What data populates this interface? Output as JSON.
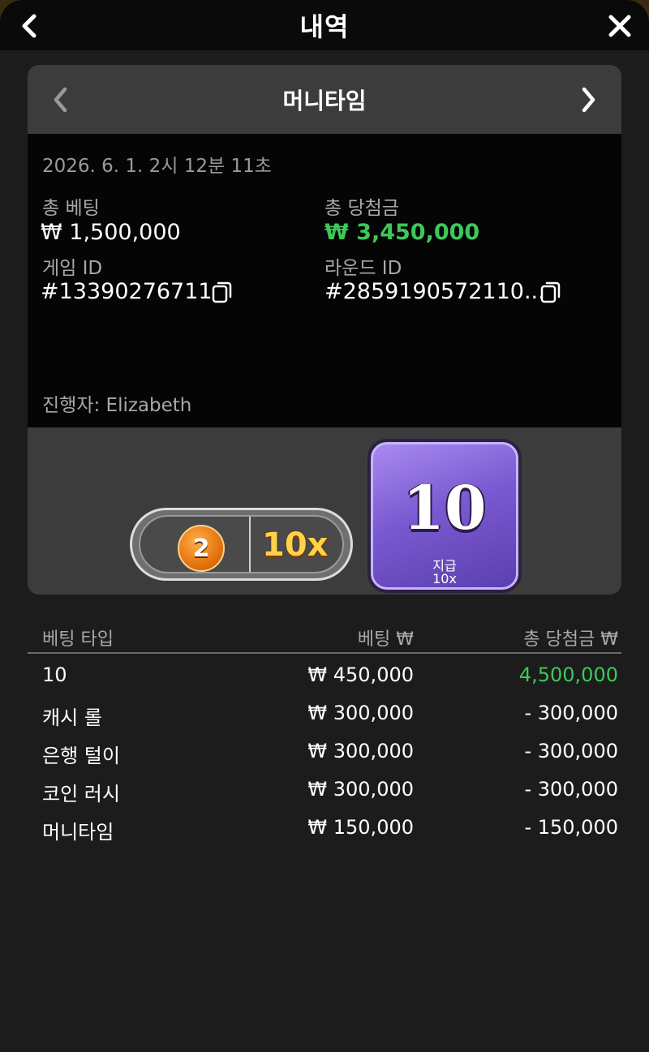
{
  "header": {
    "title": "내역"
  },
  "card": {
    "game_name": "머니타임",
    "datetime": "2026. 6. 1. 2시 12분 11초",
    "total_bet_label": "총 베팅",
    "total_bet": "₩ 1,500,000",
    "total_win_label": "총 당첨금",
    "total_win": "₩ 3,450,000",
    "game_id_label": "게임 ID",
    "game_id": "#13390276711",
    "round_id_label": "라운드 ID",
    "round_id": "#2859190572110...",
    "host": "진행자: Elizabeth",
    "result": {
      "coin_number": "2",
      "pill_multiplier": "10x",
      "tile_number": "10",
      "tile_pay_label": "지급",
      "tile_pay_multiplier": "10x",
      "bar_multiplier": "10x"
    }
  },
  "table": {
    "headers": [
      "베팅 타입",
      "베팅 ₩",
      "총 당첨금 ₩"
    ],
    "rows": [
      {
        "type": "10",
        "bet": "₩ 450,000",
        "win": "4,500,000"
      },
      {
        "type": "캐시 롤",
        "bet": "₩ 300,000",
        "win": "- 300,000"
      },
      {
        "type": "은행 털이",
        "bet": "₩ 300,000",
        "win": "- 300,000"
      },
      {
        "type": "코인 러시",
        "bet": "₩ 300,000",
        "win": "- 300,000"
      },
      {
        "type": "머니타임",
        "bet": "₩ 150,000",
        "win": "- 150,000"
      }
    ]
  },
  "colors": {
    "win_green": "#3ec85a",
    "tile_purple": "#7a5ad0",
    "multiplier_gold": "#ffd24a"
  }
}
